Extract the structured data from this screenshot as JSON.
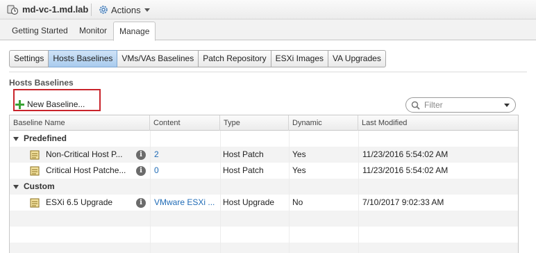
{
  "header": {
    "host_name": "md-vc-1.md.lab",
    "actions_label": "Actions"
  },
  "main_tabs": [
    {
      "label": "Getting Started"
    },
    {
      "label": "Monitor"
    },
    {
      "label": "Manage",
      "active": true
    }
  ],
  "sub_tabs": [
    {
      "label": "Settings"
    },
    {
      "label": "Hosts Baselines",
      "active": true
    },
    {
      "label": "VMs/VAs Baselines"
    },
    {
      "label": "Patch Repository"
    },
    {
      "label": "ESXi Images"
    },
    {
      "label": "VA Upgrades"
    }
  ],
  "section_title": "Hosts Baselines",
  "toolbar": {
    "new_baseline_label": "New Baseline..."
  },
  "filter": {
    "placeholder": "Filter"
  },
  "table": {
    "columns": [
      "Baseline Name",
      "Content",
      "Type",
      "Dynamic",
      "Last Modified"
    ],
    "groups": [
      {
        "name": "Predefined",
        "rows": [
          {
            "name": "Non-Critical Host P...",
            "content": "2",
            "type": "Host Patch",
            "dynamic": "Yes",
            "last_modified": "11/23/2016 5:54:02 AM"
          },
          {
            "name": "Critical Host Patche...",
            "content": "0",
            "type": "Host Patch",
            "dynamic": "Yes",
            "last_modified": "11/23/2016 5:54:02 AM"
          }
        ]
      },
      {
        "name": "Custom",
        "rows": [
          {
            "name": "ESXi 6.5 Upgrade",
            "content": "VMware ESXi ...",
            "type": "Host Upgrade",
            "dynamic": "No",
            "last_modified": "7/10/2017 9:02:33 AM"
          }
        ]
      }
    ]
  },
  "colors": {
    "active_subtab": "#a9cbee",
    "link": "#1f6bb6",
    "highlight_box": "#c9242b"
  }
}
